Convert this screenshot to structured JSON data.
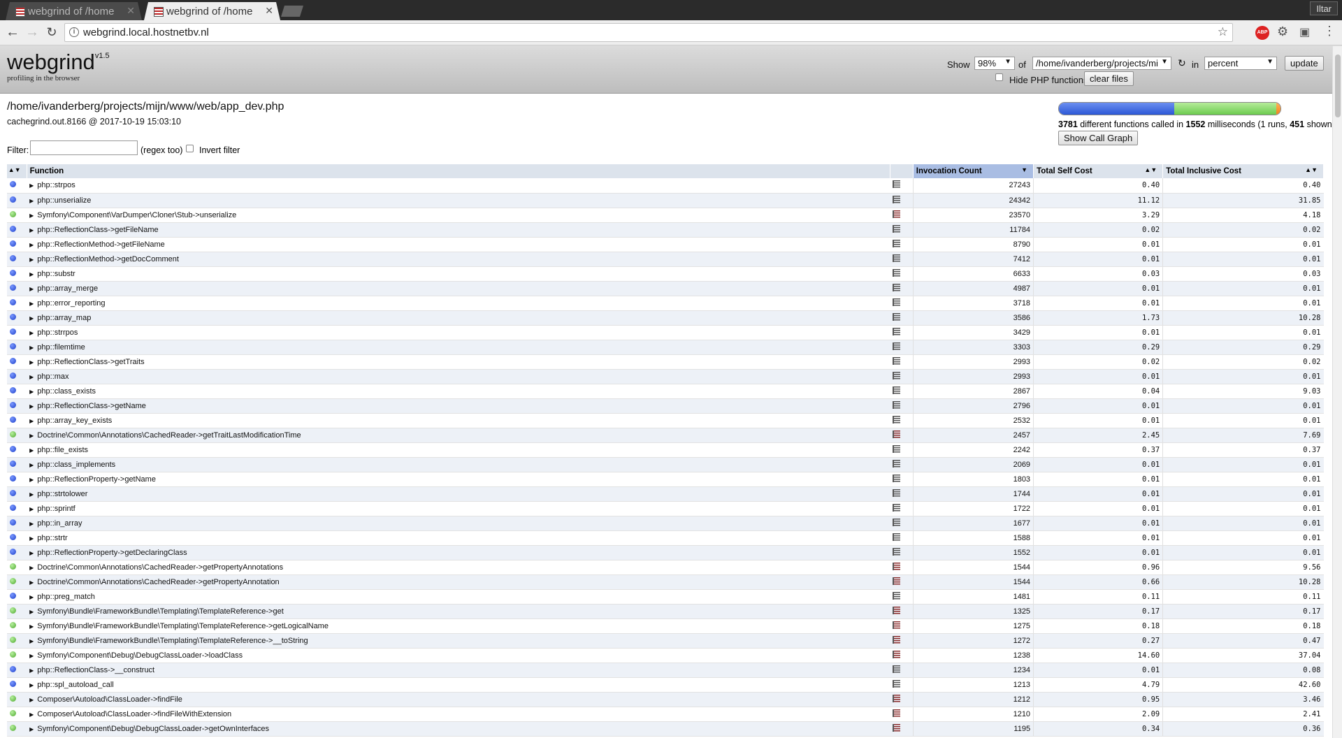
{
  "browser": {
    "tabs": [
      {
        "title": "webgrind of /home",
        "active": false
      },
      {
        "title": "webgrind of /home",
        "active": true
      }
    ],
    "user": "Iltar",
    "url": "webgrind.local.hostnetbv.nl",
    "extensions": [
      "ABP"
    ]
  },
  "header": {
    "logo": "webgrind",
    "version": "v1.5",
    "tagline": "profiling in the browser",
    "show_label": "Show",
    "show_value": "98%",
    "of_label": "of",
    "file_value": "/home/ivanderberg/projects/mi",
    "in_label": "in",
    "unit_value": "percent",
    "update_label": "update",
    "hide_php_label": "Hide PHP functions",
    "clear_files_label": "clear files"
  },
  "file": {
    "path": "/home/ivanderberg/projects/mijn/www/web/app_dev.php",
    "meta": "cachegrind.out.8166 @ 2017-10-19 15:03:10"
  },
  "filter": {
    "label": "Filter:",
    "hint": "(regex too)",
    "invert_label": "Invert filter",
    "value": ""
  },
  "summary": {
    "functions": "3781",
    "text1": " different functions called in ",
    "ms": "1552",
    "text2": " milliseconds (1 runs, ",
    "shown": "451",
    "text3": " shown)",
    "callgraph_label": "Show Call Graph",
    "breakdown": {
      "internal": 0.52,
      "user": 0.46,
      "other": 0.02
    }
  },
  "table": {
    "headers": {
      "function": "Function",
      "invocation": "Invocation Count",
      "self": "Total Self Cost",
      "inclusive": "Total Inclusive Cost"
    },
    "rows": [
      {
        "kind": "blue",
        "name": "php::strpos",
        "count": "27243",
        "self": "0.40",
        "incl": "0.40"
      },
      {
        "kind": "blue",
        "name": "php::unserialize",
        "count": "24342",
        "self": "11.12",
        "incl": "31.85"
      },
      {
        "kind": "green",
        "name": "Symfony\\Component\\VarDumper\\Cloner\\Stub->unserialize",
        "count": "23570",
        "self": "3.29",
        "incl": "4.18"
      },
      {
        "kind": "blue",
        "name": "php::ReflectionClass->getFileName",
        "count": "11784",
        "self": "0.02",
        "incl": "0.02"
      },
      {
        "kind": "blue",
        "name": "php::ReflectionMethod->getFileName",
        "count": "8790",
        "self": "0.01",
        "incl": "0.01"
      },
      {
        "kind": "blue",
        "name": "php::ReflectionMethod->getDocComment",
        "count": "7412",
        "self": "0.01",
        "incl": "0.01"
      },
      {
        "kind": "blue",
        "name": "php::substr",
        "count": "6633",
        "self": "0.03",
        "incl": "0.03"
      },
      {
        "kind": "blue",
        "name": "php::array_merge",
        "count": "4987",
        "self": "0.01",
        "incl": "0.01"
      },
      {
        "kind": "blue",
        "name": "php::error_reporting",
        "count": "3718",
        "self": "0.01",
        "incl": "0.01"
      },
      {
        "kind": "blue",
        "name": "php::array_map",
        "count": "3586",
        "self": "1.73",
        "incl": "10.28"
      },
      {
        "kind": "blue",
        "name": "php::strrpos",
        "count": "3429",
        "self": "0.01",
        "incl": "0.01"
      },
      {
        "kind": "blue",
        "name": "php::filemtime",
        "count": "3303",
        "self": "0.29",
        "incl": "0.29"
      },
      {
        "kind": "blue",
        "name": "php::ReflectionClass->getTraits",
        "count": "2993",
        "self": "0.02",
        "incl": "0.02"
      },
      {
        "kind": "blue",
        "name": "php::max",
        "count": "2993",
        "self": "0.01",
        "incl": "0.01"
      },
      {
        "kind": "blue",
        "name": "php::class_exists",
        "count": "2867",
        "self": "0.04",
        "incl": "9.03"
      },
      {
        "kind": "blue",
        "name": "php::ReflectionClass->getName",
        "count": "2796",
        "self": "0.01",
        "incl": "0.01"
      },
      {
        "kind": "blue",
        "name": "php::array_key_exists",
        "count": "2532",
        "self": "0.01",
        "incl": "0.01"
      },
      {
        "kind": "green",
        "name": "Doctrine\\Common\\Annotations\\CachedReader->getTraitLastModificationTime",
        "count": "2457",
        "self": "2.45",
        "incl": "7.69"
      },
      {
        "kind": "blue",
        "name": "php::file_exists",
        "count": "2242",
        "self": "0.37",
        "incl": "0.37"
      },
      {
        "kind": "blue",
        "name": "php::class_implements",
        "count": "2069",
        "self": "0.01",
        "incl": "0.01"
      },
      {
        "kind": "blue",
        "name": "php::ReflectionProperty->getName",
        "count": "1803",
        "self": "0.01",
        "incl": "0.01"
      },
      {
        "kind": "blue",
        "name": "php::strtolower",
        "count": "1744",
        "self": "0.01",
        "incl": "0.01"
      },
      {
        "kind": "blue",
        "name": "php::sprintf",
        "count": "1722",
        "self": "0.01",
        "incl": "0.01"
      },
      {
        "kind": "blue",
        "name": "php::in_array",
        "count": "1677",
        "self": "0.01",
        "incl": "0.01"
      },
      {
        "kind": "blue",
        "name": "php::strtr",
        "count": "1588",
        "self": "0.01",
        "incl": "0.01"
      },
      {
        "kind": "blue",
        "name": "php::ReflectionProperty->getDeclaringClass",
        "count": "1552",
        "self": "0.01",
        "incl": "0.01"
      },
      {
        "kind": "green",
        "name": "Doctrine\\Common\\Annotations\\CachedReader->getPropertyAnnotations",
        "count": "1544",
        "self": "0.96",
        "incl": "9.56"
      },
      {
        "kind": "green",
        "name": "Doctrine\\Common\\Annotations\\CachedReader->getPropertyAnnotation",
        "count": "1544",
        "self": "0.66",
        "incl": "10.28"
      },
      {
        "kind": "blue",
        "name": "php::preg_match",
        "count": "1481",
        "self": "0.11",
        "incl": "0.11"
      },
      {
        "kind": "green",
        "name": "Symfony\\Bundle\\FrameworkBundle\\Templating\\TemplateReference->get",
        "count": "1325",
        "self": "0.17",
        "incl": "0.17"
      },
      {
        "kind": "green",
        "name": "Symfony\\Bundle\\FrameworkBundle\\Templating\\TemplateReference->getLogicalName",
        "count": "1275",
        "self": "0.18",
        "incl": "0.18"
      },
      {
        "kind": "green",
        "name": "Symfony\\Bundle\\FrameworkBundle\\Templating\\TemplateReference->__toString",
        "count": "1272",
        "self": "0.27",
        "incl": "0.47"
      },
      {
        "kind": "green",
        "name": "Symfony\\Component\\Debug\\DebugClassLoader->loadClass",
        "count": "1238",
        "self": "14.60",
        "incl": "37.04"
      },
      {
        "kind": "blue",
        "name": "php::ReflectionClass->__construct",
        "count": "1234",
        "self": "0.01",
        "incl": "0.08"
      },
      {
        "kind": "blue",
        "name": "php::spl_autoload_call",
        "count": "1213",
        "self": "4.79",
        "incl": "42.60"
      },
      {
        "kind": "green",
        "name": "Composer\\Autoload\\ClassLoader->findFile",
        "count": "1212",
        "self": "0.95",
        "incl": "3.46"
      },
      {
        "kind": "green",
        "name": "Composer\\Autoload\\ClassLoader->findFileWithExtension",
        "count": "1210",
        "self": "2.09",
        "incl": "2.41"
      },
      {
        "kind": "green",
        "name": "Symfony\\Component\\Debug\\DebugClassLoader->getOwnInterfaces",
        "count": "1195",
        "self": "0.34",
        "incl": "0.36"
      }
    ]
  }
}
